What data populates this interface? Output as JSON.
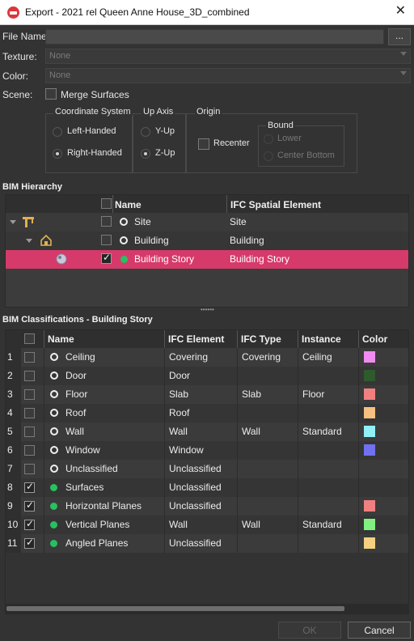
{
  "window": {
    "title": "Export - 2021 rel Queen Anne House_3D_combined"
  },
  "form": {
    "file_name_label": "File Name:",
    "file_name_value": "",
    "browse_label": "...",
    "texture_label": "Texture:",
    "texture_value": "None",
    "color_label": "Color:",
    "color_value": "None",
    "scene_label": "Scene:",
    "merge_surfaces_label": "Merge Surfaces"
  },
  "coordinate_system": {
    "title": "Coordinate System",
    "options": [
      "Left-Handed",
      "Right-Handed"
    ],
    "selected": "Right-Handed"
  },
  "up_axis": {
    "title": "Up Axis",
    "options": [
      "Y-Up",
      "Z-Up"
    ],
    "selected": "Z-Up"
  },
  "origin": {
    "title": "Origin",
    "recenter_label": "Recenter",
    "bound_title": "Bound",
    "bound_options": [
      "Lower",
      "Center Bottom"
    ]
  },
  "bim_hierarchy": {
    "title": "BIM Hierarchy",
    "columns": [
      "Name",
      "IFC Spatial Element"
    ],
    "rows": [
      {
        "name": "Site",
        "ifc": "Site",
        "checked": false,
        "selected": false
      },
      {
        "name": "Building",
        "ifc": "Building",
        "checked": false,
        "selected": false
      },
      {
        "name": "Building Story",
        "ifc": "Building Story",
        "checked": true,
        "selected": true
      }
    ]
  },
  "bim_classifications": {
    "title": "BIM Classifications - Building Story",
    "columns": [
      "Name",
      "IFC Element",
      "IFC Type",
      "Instance",
      "Color"
    ],
    "rows": [
      {
        "num": "1",
        "name": "Ceiling",
        "ifc": "Covering",
        "type": "Covering",
        "instance": "Ceiling",
        "color": "#f08cf0",
        "checked": false
      },
      {
        "num": "2",
        "name": "Door",
        "ifc": "Door",
        "type": "",
        "instance": "",
        "color": "#2e5a2e",
        "checked": false
      },
      {
        "num": "3",
        "name": "Floor",
        "ifc": "Slab",
        "type": "Slab",
        "instance": "Floor",
        "color": "#f08080",
        "checked": false
      },
      {
        "num": "4",
        "name": "Roof",
        "ifc": "Roof",
        "type": "",
        "instance": "",
        "color": "#f5c080",
        "checked": false
      },
      {
        "num": "5",
        "name": "Wall",
        "ifc": "Wall",
        "type": "Wall",
        "instance": "Standard",
        "color": "#90f0f5",
        "checked": false
      },
      {
        "num": "6",
        "name": "Window",
        "ifc": "Window",
        "type": "",
        "instance": "",
        "color": "#7070f0",
        "checked": false
      },
      {
        "num": "7",
        "name": "Unclassified",
        "ifc": "Unclassified",
        "type": "",
        "instance": "",
        "color": "",
        "checked": false
      },
      {
        "num": "8",
        "name": "Surfaces",
        "ifc": "Unclassified",
        "type": "",
        "instance": "",
        "color": "",
        "checked": true
      },
      {
        "num": "9",
        "name": "Horizontal Planes",
        "ifc": "Unclassified",
        "type": "",
        "instance": "",
        "color": "#f08080",
        "checked": true
      },
      {
        "num": "10",
        "name": "Vertical Planes",
        "ifc": "Wall",
        "type": "Wall",
        "instance": "Standard",
        "color": "#80f080",
        "checked": true
      },
      {
        "num": "11",
        "name": "Angled Planes",
        "ifc": "Unclassified",
        "type": "",
        "instance": "",
        "color": "#f5d080",
        "checked": true
      }
    ]
  },
  "buttons": {
    "ok": "OK",
    "cancel": "Cancel"
  }
}
